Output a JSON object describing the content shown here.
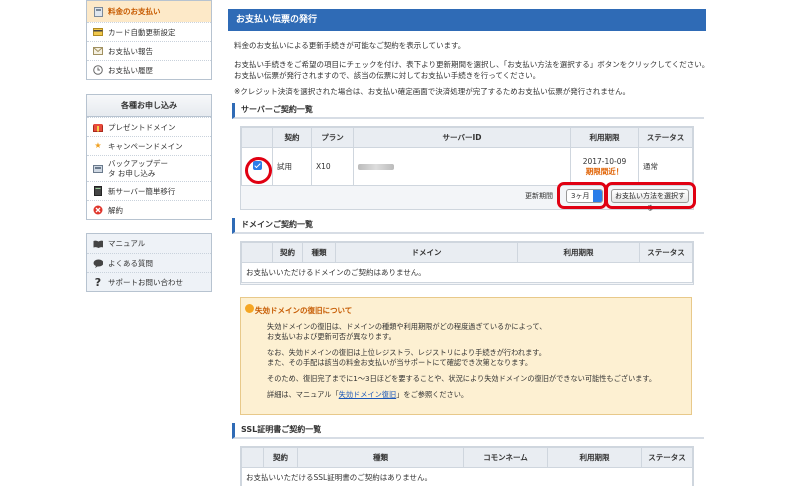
{
  "sidebar": {
    "top_items": [
      {
        "label": "料金のお支払い",
        "icon": "calculator-icon"
      },
      {
        "label": "カード自動更新設定",
        "icon": "credit-card-icon"
      },
      {
        "label": "お支払い報告",
        "icon": "envelope-icon"
      },
      {
        "label": "お支払い履歴",
        "icon": "clock-icon"
      }
    ],
    "mid_heading": "各種お申し込み",
    "mid_items": [
      {
        "label": "プレゼントドメイン",
        "icon": "gift-icon"
      },
      {
        "label": "キャンペーンドメイン",
        "icon": "star-icon"
      },
      {
        "label": "バックアップデータ お申し込み",
        "icon": "backup-icon"
      },
      {
        "label": "新サーバー簡単移行",
        "icon": "server-icon"
      },
      {
        "label": "解約",
        "icon": "cancel-icon"
      }
    ],
    "bottom_items": [
      {
        "label": "マニュアル",
        "icon": "book-icon"
      },
      {
        "label": "よくある質問",
        "icon": "speech-bubble-icon"
      },
      {
        "label": "サポートお問い合わせ",
        "icon": "question-icon"
      }
    ]
  },
  "main": {
    "title": "お支払い伝票の発行",
    "intro": [
      "料金のお支払いによる更新手続きが可能なご契約を表示しています。",
      "お支払い手続きをご希望の項目にチェックを付け、表下より更新期間を選択し、「お支払い方法を選択する」ボタンをクリックしてください。",
      "お支払い伝票が発行されますので、該当の伝票に対してお支払い手続きを行ってください。",
      "※クレジット決済を選択された場合は、お支払い確定画面で決済処理が完了するためお支払い伝票が発行されません。"
    ],
    "server_section": {
      "heading": "サーバーご契約一覧",
      "columns": [
        "",
        "契約",
        "プラン",
        "サーバーID",
        "利用期限",
        "ステータス"
      ],
      "row": {
        "contract": "試用",
        "plan": "X10",
        "expiry": "2017-10-09",
        "expiry_note": "期限間近！",
        "status": "通常"
      },
      "period_label": "更新期間",
      "period_value": "3ヶ月",
      "pay_button": "お支払い方法を選択する"
    },
    "domain_section": {
      "heading": "ドメインご契約一覧",
      "columns": [
        "",
        "契約",
        "種類",
        "ドメイン",
        "利用期限",
        "ステータス"
      ],
      "empty": "お支払いいただけるドメインのご契約はありません。"
    },
    "notice": {
      "title": "失効ドメインの復旧について",
      "lines": [
        "失効ドメインの復旧は、ドメインの種類や利用期限がどの程度過ぎているかによって、",
        "お支払いおよび更新可否が異なります。",
        "なお、失効ドメインの復旧は上位レジストラ、レジストリにより手続きが行われます。",
        "また、その手配は該当の料金お支払いが当サポートにて確認でき次第となります。",
        "そのため、復旧完了までに1〜3日ほどを要することや、状況により失効ドメインの復旧ができない可能性もございます。"
      ],
      "detail_prefix": "詳細は、マニュアル「",
      "detail_link": "失効ドメイン復旧",
      "detail_suffix": "」をご参照ください。"
    },
    "ssl_section": {
      "heading": "SSL証明書ご契約一覧",
      "columns": [
        "",
        "契約",
        "種類",
        "コモンネーム",
        "利用期限",
        "ステータス"
      ],
      "empty": "お支払いいただけるSSL証明書のご契約はありません。"
    }
  },
  "colors": {
    "title_bar": "#2f6bb6",
    "highlight_ring": "#e00012",
    "active_item": "#fde9c8",
    "notice_bg": "#fdf0d2"
  }
}
